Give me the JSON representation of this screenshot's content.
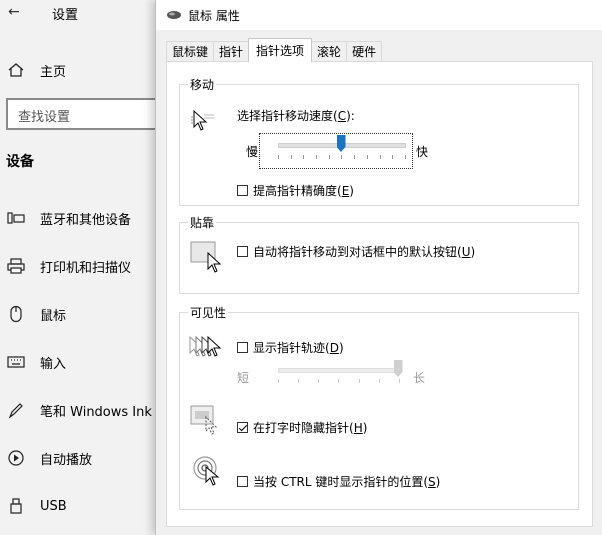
{
  "settings": {
    "back_glyph": "←",
    "title": "设置",
    "home_label": "主页",
    "search_placeholder": "查找设置",
    "section_title": "设备",
    "nav": [
      {
        "label": "蓝牙和其他设备",
        "icon": "bluetooth-devices-icon"
      },
      {
        "label": "打印机和扫描仪",
        "icon": "printer-icon"
      },
      {
        "label": "鼠标",
        "icon": "mouse-icon"
      },
      {
        "label": "输入",
        "icon": "keyboard-icon"
      },
      {
        "label": "笔和 Windows Ink",
        "icon": "pen-icon"
      },
      {
        "label": "自动播放",
        "icon": "autoplay-icon"
      },
      {
        "label": "USB",
        "icon": "usb-icon"
      }
    ]
  },
  "dialog": {
    "title": "鼠标 属性",
    "tabs": [
      "鼠标键",
      "指针",
      "指针选项",
      "滚轮",
      "硬件"
    ],
    "active_tab": "指针选项",
    "motion": {
      "group": "移动",
      "speed_label_pre": "选择指针移动速度(",
      "speed_key": "C",
      "speed_label_post": "):",
      "slow": "慢",
      "fast": "快",
      "speed_value_fraction": 0.5,
      "precision_pre": "提高指针精确度(",
      "precision_key": "E",
      "precision_post": ")",
      "precision_checked": false
    },
    "snap": {
      "group": "贴靠",
      "label_pre": "自动将指针移动到对话框中的默认按钮(",
      "key": "U",
      "label_post": ")",
      "checked": false
    },
    "visibility": {
      "group": "可见性",
      "trails_pre": "显示指针轨迹(",
      "trails_key": "D",
      "trails_post": ")",
      "trails_checked": false,
      "short": "短",
      "long": "长",
      "trails_value_fraction": 1.0,
      "hide_pre": "在打字时隐藏指针(",
      "hide_key": "H",
      "hide_post": ")",
      "hide_checked": true,
      "ctrl_pre": "当按 CTRL 键时显示指针的位置(",
      "ctrl_key": "S",
      "ctrl_post": ")",
      "ctrl_checked": false
    }
  },
  "colors": {
    "accent": "#0078d7",
    "slider_thumb": "#1a73c6"
  }
}
